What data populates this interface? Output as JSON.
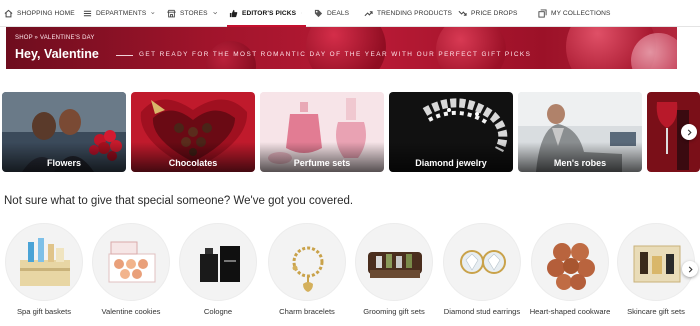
{
  "nav": {
    "items": [
      {
        "label": "Shopping Home",
        "icon": "home-icon",
        "dropdown": false,
        "active": false
      },
      {
        "label": "Departments",
        "icon": "list-icon",
        "dropdown": true,
        "active": false
      },
      {
        "label": "Stores",
        "icon": "store-icon",
        "dropdown": true,
        "active": false
      },
      {
        "label": "Editor's Picks",
        "icon": "thumb-up-icon",
        "dropdown": true,
        "active": true
      },
      {
        "label": "Deals",
        "icon": "tag-icon",
        "dropdown": false,
        "active": false
      },
      {
        "label": "Trending Products",
        "icon": "trend-icon",
        "dropdown": false,
        "active": false
      },
      {
        "label": "Price Drops",
        "icon": "price-drop-icon",
        "dropdown": false,
        "active": false
      },
      {
        "label": "My Collections",
        "icon": "collections-icon",
        "dropdown": false,
        "active": false
      }
    ]
  },
  "hero": {
    "breadcrumb": "SHOP » VALENTINE'S DAY",
    "title": "Hey, Valentine",
    "subtitle": "GET READY FOR THE MOST ROMANTIC DAY OF THE YEAR WITH OUR PERFECT GIFT PICKS"
  },
  "categories": [
    {
      "label": "Flowers"
    },
    {
      "label": "Chocolates"
    },
    {
      "label": "Perfume sets"
    },
    {
      "label": "Diamond jewelry"
    },
    {
      "label": "Men's robes"
    },
    {
      "label": ""
    }
  ],
  "section": {
    "heading": "Not sure what to give that special someone? We've got you covered."
  },
  "gifts": [
    {
      "label": "Spa gift baskets"
    },
    {
      "label": "Valentine cookies"
    },
    {
      "label": "Cologne"
    },
    {
      "label": "Charm bracelets"
    },
    {
      "label": "Grooming gift sets"
    },
    {
      "label": "Diamond stud earrings"
    },
    {
      "label": "Heart-shaped cookware"
    },
    {
      "label": "Skincare gift sets"
    }
  ],
  "colors": {
    "accent": "#c4102e",
    "banner": "#a0142b"
  }
}
